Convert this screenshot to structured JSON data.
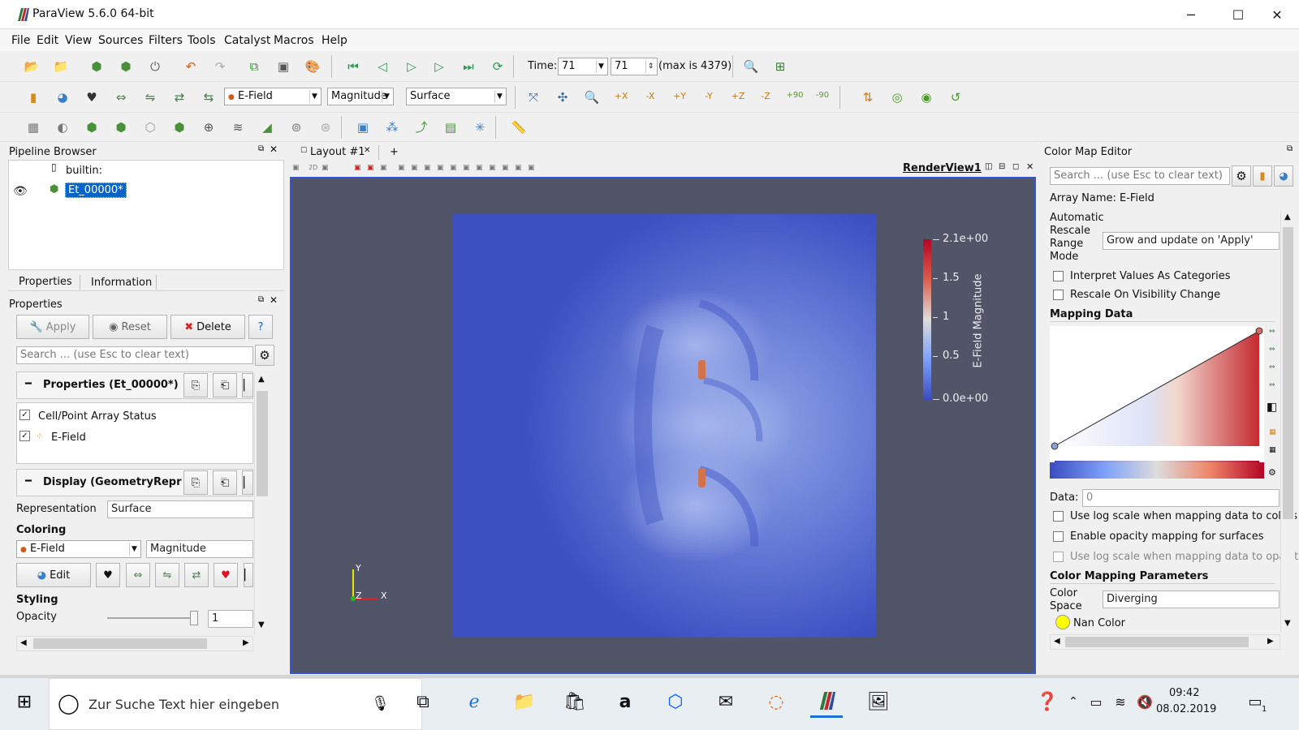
{
  "window": {
    "title": "ParaView 5.6.0 64-bit",
    "min": "─",
    "max": "☐",
    "close": "✕"
  },
  "menu": [
    "File",
    "Edit",
    "View",
    "Sources",
    "Filters",
    "Tools",
    "Catalyst",
    "Macros",
    "Help"
  ],
  "toolbar": {
    "time_label": "Time:",
    "time_value": "71",
    "time_index": "71",
    "time_max": "(max is 4379)",
    "array_select": "E-Field",
    "component_select": "Magnitude",
    "representation_select": "Surface",
    "camera_labels": [
      "+X",
      "-X",
      "+Y",
      "-Y",
      "+Z",
      "-Z",
      "+90",
      "-90"
    ]
  },
  "pipeline": {
    "title": "Pipeline Browser",
    "items": [
      {
        "label": "builtin:"
      },
      {
        "label": "Et_00000*"
      }
    ]
  },
  "prop_tabs": [
    "Properties",
    "Information"
  ],
  "properties": {
    "title": "Properties",
    "apply": "Apply",
    "reset": "Reset",
    "delete": "Delete",
    "help": "?",
    "search_placeholder": "Search ... (use Esc to clear text)",
    "section_props": "Properties (Et_00000*)",
    "cell_point_status": "Cell/Point Array Status",
    "array_item": "E-Field",
    "section_display": "Display (GeometryRepr",
    "representation_label": "Representation",
    "representation_value": "Surface",
    "coloring_label": "Coloring",
    "coloring_array": "E-Field",
    "coloring_component": "Magnitude",
    "edit": "Edit",
    "styling_label": "Styling",
    "opacity_label": "Opacity",
    "opacity_value": "1",
    "opacity_level": 1.0
  },
  "layout": {
    "tab": "Layout #1",
    "add": "+",
    "view_name": "RenderView1"
  },
  "colorbar": {
    "title": "E-Field Magnitude",
    "ticks": [
      "2.1e+00",
      "1.5",
      "1",
      "0.5",
      "0.0e+00"
    ]
  },
  "axes": {
    "y": "Y",
    "z": "Z",
    "x": "X"
  },
  "cme": {
    "title": "Color Map Editor",
    "search_placeholder": "Search ... (use Esc to clear text)",
    "array_name": "Array Name: E-Field",
    "rescale_label_lines": [
      "Automatic",
      "Rescale",
      "Range",
      "Mode"
    ],
    "rescale_value": "Grow and update on 'Apply'",
    "interpret_categories": "Interpret Values As Categories",
    "rescale_visibility": "Rescale On Visibility Change",
    "mapping_data": "Mapping Data",
    "data_label": "Data:",
    "data_value": "0",
    "log_colors": "Use log scale when mapping data to colors",
    "opacity_mapping": "Enable opacity mapping for surfaces",
    "log_opacity": "Use log scale when mapping data to opacity",
    "color_params": "Color Mapping Parameters",
    "color_space_lines": [
      "Color",
      "Space"
    ],
    "color_space_value": "Diverging",
    "nan_color": "Nan Color"
  },
  "taskbar": {
    "search_placeholder": "Zur Suche Text hier eingeben",
    "time": "09:42",
    "date": "08.02.2019",
    "notif_count": "1"
  },
  "colors": {
    "accent": "#3aa0d6",
    "selection": "#0a64c8",
    "viewBg": "#525468",
    "fieldBg": "#3b4fc3"
  }
}
